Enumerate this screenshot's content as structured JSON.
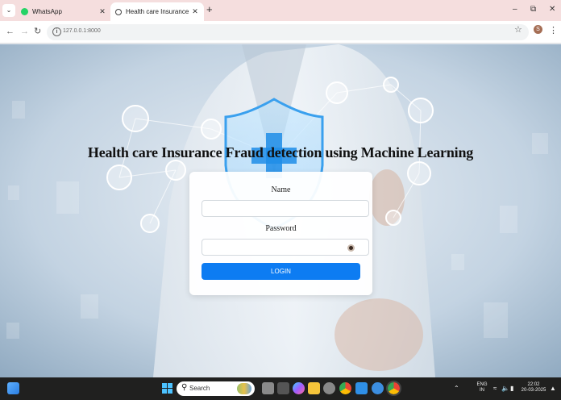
{
  "browser": {
    "tabs": [
      {
        "title": "WhatsApp",
        "favicon": "whatsapp-icon",
        "active": false
      },
      {
        "title": "Health care Insurance Fraud de",
        "favicon": "globe-icon",
        "active": true
      }
    ],
    "url": "127.0.0.1:8000",
    "profile_initial": "S"
  },
  "page": {
    "title": "Health care Insurance Fraud detection using Machine Learning",
    "form": {
      "name_label": "Name",
      "name_value": "",
      "password_label": "Password",
      "password_value": "",
      "login_label": "LOGIN"
    },
    "accent_color": "#0d7cf2"
  },
  "taskbar": {
    "search_placeholder": "Search",
    "language": "ENG",
    "region": "IN",
    "time": "22:02",
    "date": "20-03-2025"
  }
}
